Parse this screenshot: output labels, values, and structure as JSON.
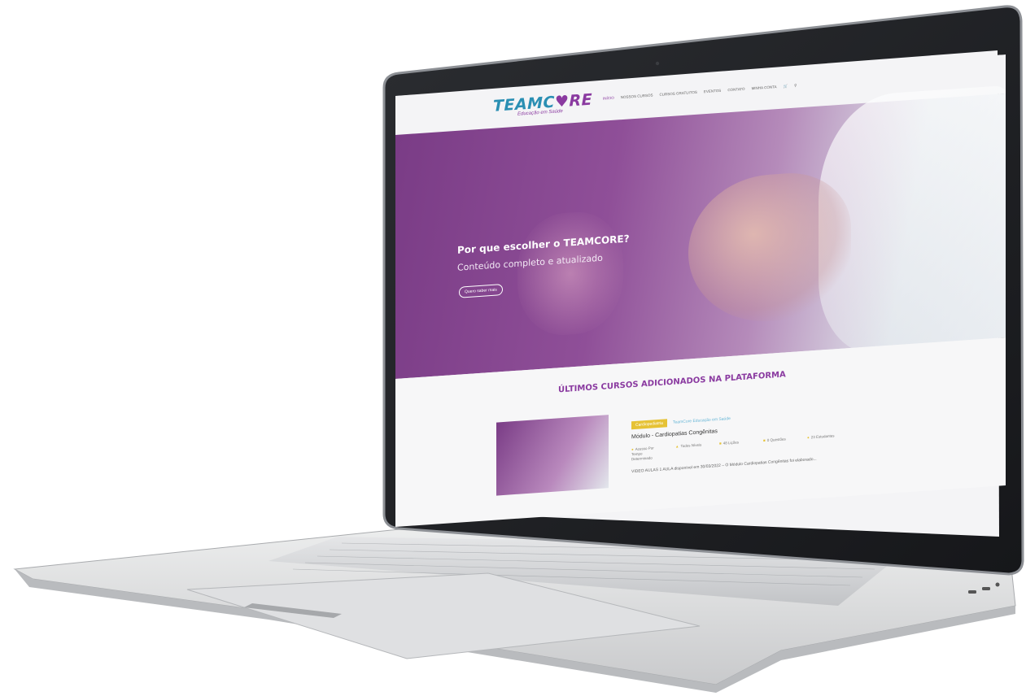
{
  "nav": {
    "logo_team": "TEAMC",
    "logo_heart": "♥",
    "logo_re": "RE",
    "tagline": "Educação em Saúde",
    "menu": [
      "INÍCIO",
      "NOSSOS CURSOS",
      "CURSOS GRATUITOS",
      "EVENTOS",
      "CONTATO",
      "MINHA CONTA"
    ],
    "cart_icon": "cart-icon",
    "search_icon": "search-icon"
  },
  "hero": {
    "title": "Por que escolher o TEAMCORE?",
    "subtitle": "Conteúdo completo e atualizado",
    "button": "Quero saber mais"
  },
  "section": {
    "title": "ÚLTIMOS CURSOS ADICIONADOS NA PLATAFORMA"
  },
  "course": {
    "badge_primary": "Cardiopediatria",
    "badge_secondary": "TeamCore Educação em Saúde",
    "title": "Módulo - Cardiopatias Congênitas",
    "meta": [
      {
        "label": "Acesso Por Tempo Determinado"
      },
      {
        "label": "Todos Níveis"
      },
      {
        "label": "48 Lições"
      },
      {
        "label": "0 Questões"
      },
      {
        "label": "23 Estudantes"
      }
    ],
    "description": "VIDEO AULAS 1 AULA disponível em 30/03/2022 – O Módulo Cardiopatias Congênitas foi elaborado..."
  },
  "colors": {
    "brand_purple": "#8a3aa0",
    "brand_blue": "#2a8fb3",
    "badge_yellow": "#e6c235",
    "laptop_silver": "#d9dadc"
  }
}
